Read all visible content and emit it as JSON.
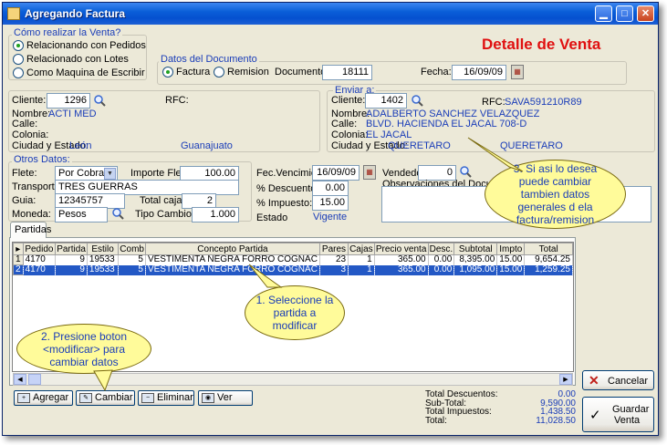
{
  "window": {
    "title": "Agregando Factura"
  },
  "header": {
    "title": "Detalle de Venta"
  },
  "como": {
    "title": "Cómo realizar la Venta?",
    "options": [
      "Relacionando con Pedidos",
      "Relacionado con Lotes",
      "Como Maquina de Escribir"
    ]
  },
  "documento": {
    "title": "Datos del Documento",
    "opt_factura": "Factura",
    "opt_remision": "Remision",
    "doc_label": "Documento:",
    "doc_value": "18111",
    "fecha_label": "Fecha:",
    "fecha_value": "16/09/09"
  },
  "cliente": {
    "label": "Cliente:",
    "value": "1296",
    "rfc_label": "RFC:",
    "nombre_label": "Nombre:",
    "nombre": "ACTI MED",
    "calle_label": "Calle:",
    "colonia_label": "Colonia:",
    "ciudad_label": "Ciudad y Estado:",
    "ciudad": "León",
    "estado": "Guanajuato"
  },
  "enviar": {
    "title": "Enviar a:",
    "label": "Cliente:",
    "value": "1402",
    "rfc_label": "RFC:",
    "rfc": "SAVA591210R89",
    "nombre_label": "Nombre:",
    "nombre": "ADALBERTO SANCHEZ VELAZQUEZ",
    "calle_label": "Calle:",
    "calle": "BLVD. HACIENDA EL JACAL 708-D",
    "colonia_label": "Colonia:",
    "colonia": "EL JACAL",
    "ciudad_label": "Ciudad y Estado:",
    "ciudad": "QUERETARO",
    "estado": "QUERETARO"
  },
  "otros": {
    "title": "Otros Datos:",
    "flete_label": "Flete:",
    "flete_value": "Por Cobrar",
    "importe_flete_label": "Importe Flete:",
    "importe_flete": "100.00",
    "transporte_label": "Transporte:",
    "transporte": "TRES GUERRAS",
    "guia_label": "Guia:",
    "guia": "12345757",
    "total_cajas_label": "Total cajas:",
    "total_cajas": "2",
    "moneda_label": "Moneda:",
    "moneda": "Pesos",
    "tipo_cambio_label": "Tipo Cambio:",
    "tipo_cambio": "1.000"
  },
  "venc": {
    "fec_label": "Fec.Vencimiento:",
    "fec_value": "16/09/09",
    "desc_label": "% Descuento:",
    "desc_value": "0.00",
    "imp_label": "% Impuesto:",
    "imp_value": "15.00",
    "estado_label": "Estado",
    "estado_value": "Vigente"
  },
  "vendedor": {
    "label": "Vendedor:",
    "value": "0",
    "obs_label": "Observaciones del Documento:"
  },
  "tabs": {
    "partidas": "Partidas"
  },
  "grid": {
    "columns": [
      "Pedido",
      "Partida",
      "Estilo",
      "Comb",
      "Concepto Partida",
      "Pares",
      "Cajas",
      "Precio venta",
      "Desc.",
      "Subtotal",
      "Impto",
      "Total"
    ],
    "rows": [
      {
        "num": "1",
        "cells": [
          "4170",
          "9",
          "19533",
          "5",
          "VESTIMENTA NEGRA FORRO COGNAC",
          "23",
          "1",
          "365.00",
          "0.00",
          "8,395.00",
          "15.00",
          "9,654.25"
        ]
      },
      {
        "num": "2",
        "cells": [
          "4170",
          "9",
          "19533",
          "5",
          "VESTIMENTA NEGRA FORRO COGNAC",
          "3",
          "1",
          "365.00",
          "0.00",
          "1,095.00",
          "15.00",
          "1,259.25"
        ]
      }
    ]
  },
  "buttons": {
    "agregar": "Agregar",
    "cambiar": "Cambiar",
    "eliminar": "Eliminar",
    "ver": "Ver",
    "cancelar": "Cancelar",
    "guardar_line1": "Guardar",
    "guardar_line2": "Venta"
  },
  "totals": [
    {
      "label": "Total  Descuentos:",
      "value": "0.00"
    },
    {
      "label": "Sub-Total:",
      "value": "9,590.00"
    },
    {
      "label": "Total Impuestos:",
      "value": "1,438.50"
    },
    {
      "label": "Total:",
      "value": "11,028.50"
    }
  ],
  "callouts": {
    "c1": "1. Seleccione la partida a modificar",
    "c2": "2. Presione boton <modificar> para cambiar datos",
    "c3": "3. Si asi lo desea puede cambiar tambien datos generales d ela factura/remision"
  }
}
